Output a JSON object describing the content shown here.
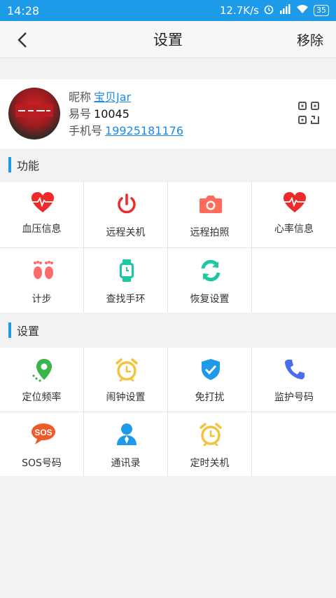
{
  "status_bar": {
    "time": "14:28",
    "speed": "12.7K/s",
    "battery": "35"
  },
  "header": {
    "title": "设置",
    "remove_label": "移除"
  },
  "profile": {
    "nickname_label": "昵称",
    "nickname": "宝贝Jar",
    "id_label": "易号",
    "id": "10045",
    "phone_label": "手机号",
    "phone": "19925181176"
  },
  "sections": {
    "functions_title": "功能",
    "settings_title": "设置"
  },
  "functions": [
    {
      "label": "血压信息",
      "icon": "heart-pulse-icon",
      "color": "#ee2b2b"
    },
    {
      "label": "远程关机",
      "icon": "power-icon",
      "color": "#ee2b2b"
    },
    {
      "label": "远程拍照",
      "icon": "camera-icon",
      "color": "#ff6b5a"
    },
    {
      "label": "心率信息",
      "icon": "heart-pulse-icon",
      "color": "#ee2b2b"
    },
    {
      "label": "计步",
      "icon": "footprints-icon",
      "color": "#ff6b6b"
    },
    {
      "label": "查找手环",
      "icon": "watch-icon",
      "color": "#1bc8a0"
    },
    {
      "label": "恢复设置",
      "icon": "refresh-icon",
      "color": "#1bc8a0"
    }
  ],
  "settings": [
    {
      "label": "定位频率",
      "icon": "location-pin-icon",
      "color": "#3ab54a"
    },
    {
      "label": "闹钟设置",
      "icon": "alarm-clock-icon",
      "color": "#f2c43d"
    },
    {
      "label": "免打扰",
      "icon": "shield-check-icon",
      "color": "#1e9be8"
    },
    {
      "label": "监护号码",
      "icon": "phone-icon",
      "color": "#4a6cf0"
    },
    {
      "label": "SOS号码",
      "icon": "sos-icon",
      "color": "#f05a28"
    },
    {
      "label": "通讯录",
      "icon": "contact-person-icon",
      "color": "#1e9be8"
    },
    {
      "label": "定时关机",
      "icon": "alarm-clock-icon",
      "color": "#f2c43d"
    }
  ]
}
